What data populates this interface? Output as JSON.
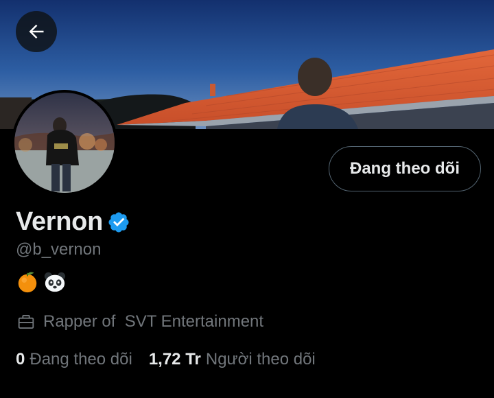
{
  "colors": {
    "background": "#000000",
    "primary_text": "#e7e9ea",
    "secondary_text": "#71767b",
    "verified_blue": "#1d9bf0",
    "button_border": "#536471"
  },
  "header": {
    "back_icon": "arrow-left-icon"
  },
  "profile": {
    "display_name": "Vernon",
    "verified_icon": "verified-badge-icon",
    "handle": "@b_vernon",
    "bio_emojis": [
      "tangerine-emoji",
      "panda-emoji"
    ],
    "follow_button_label": "Đang theo dõi",
    "work": {
      "icon": "briefcase-icon",
      "text": "Rapper of  SVT Entertainment"
    },
    "stats": {
      "following_count": "0",
      "following_label": "Đang theo dõi",
      "followers_count": "1,72 Tr",
      "followers_label": "Người theo dõi"
    }
  }
}
